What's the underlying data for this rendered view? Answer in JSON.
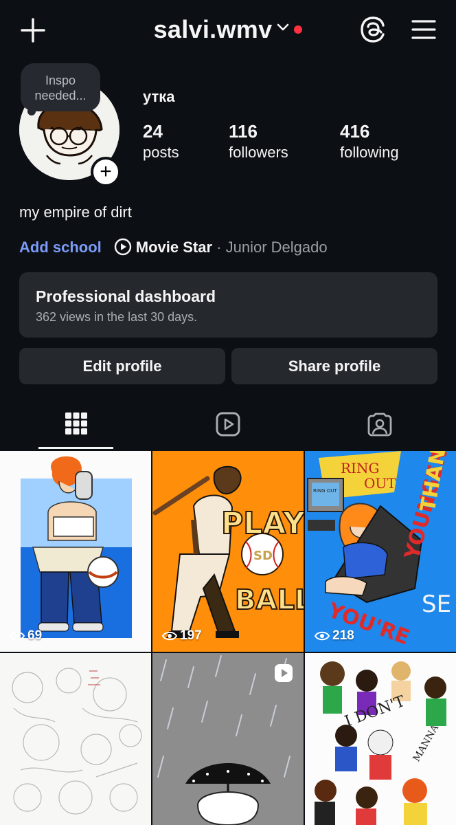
{
  "header": {
    "username": "salvi.wmv",
    "has_notification_dot": true,
    "colors": {
      "notification": "#ff3040",
      "background": "#0c1014"
    }
  },
  "note": {
    "text": "Inspo needed..."
  },
  "profile": {
    "display_name": "утка",
    "stats": [
      {
        "value": "24",
        "label": "posts"
      },
      {
        "value": "116",
        "label": "followers"
      },
      {
        "value": "416",
        "label": "following"
      }
    ],
    "bio": "my empire of dirt",
    "add_school": "Add school",
    "music": {
      "song": "Movie Star",
      "separator": " · ",
      "artist": "Junior Delgado"
    }
  },
  "dashboard": {
    "title": "Professional dashboard",
    "subtitle": "362 views in the last 30 days."
  },
  "buttons": {
    "edit": "Edit profile",
    "share": "Share profile"
  },
  "tabs": [
    {
      "icon": "grid-icon",
      "active": true
    },
    {
      "icon": "reels-icon",
      "active": false
    },
    {
      "icon": "tagged-icon",
      "active": false
    }
  ],
  "posts": [
    {
      "views": "69",
      "is_reel": false
    },
    {
      "views": "197",
      "is_reel": false
    },
    {
      "views": "218",
      "is_reel": false
    },
    {
      "views": "",
      "is_reel": false
    },
    {
      "views": "",
      "is_reel": true
    },
    {
      "views": "",
      "is_reel": false
    }
  ],
  "post_art_text": {
    "post2": [
      "PLAY",
      "BALL",
      "SD"
    ],
    "post3": [
      "RING",
      "OUT",
      "RING OUT",
      "YOU'RE",
      "YOUNGER",
      "THAN",
      "SE"
    ],
    "post6": [
      "I DON'T",
      "MANNA"
    ]
  }
}
